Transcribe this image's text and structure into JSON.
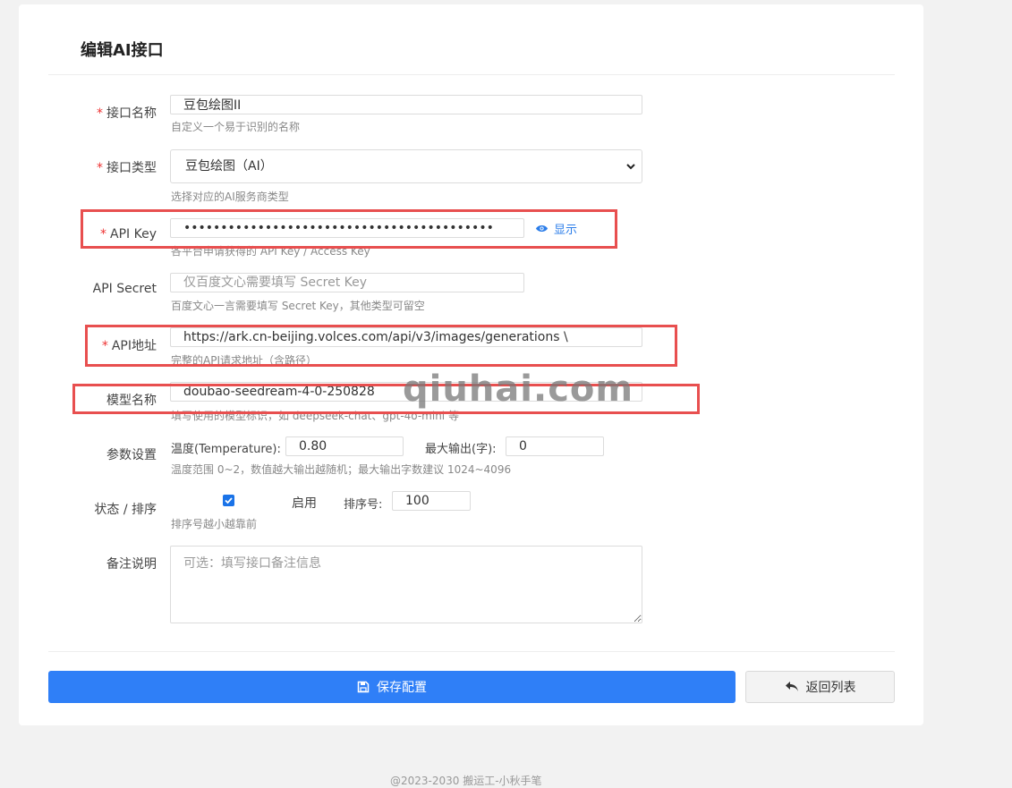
{
  "page": {
    "title": "编辑AI接口"
  },
  "form": {
    "name": {
      "label": "接口名称",
      "required": "*",
      "value": "豆包绘图II",
      "hint": "自定义一个易于识别的名称"
    },
    "type": {
      "label": "接口类型",
      "required": "*",
      "selected": "豆包绘图（AI）",
      "hint": "选择对应的AI服务商类型"
    },
    "api_key": {
      "label": "API Key",
      "required": "*",
      "value": "••••••••••••••••••••••••••••••••••••••••••",
      "show_label": "显示",
      "hint": "各平台申请获得的 API Key / Access Key"
    },
    "api_secret": {
      "label": "API Secret",
      "placeholder": "仅百度文心需要填写 Secret Key",
      "hint": "百度文心一言需要填写 Secret Key，其他类型可留空"
    },
    "api_url": {
      "label": "API地址",
      "required": "*",
      "value": "https://ark.cn-beijing.volces.com/api/v3/images/generations \\",
      "hint": "完整的API请求地址（含路径）"
    },
    "model": {
      "label": "模型名称",
      "value": "doubao-seedream-4-0-250828",
      "hint": "填写使用的模型标识，如 deepseek-chat、gpt-4o-mini 等"
    },
    "params": {
      "label": "参数设置",
      "temperature_label": "温度(Temperature):",
      "temperature_value": "0.80",
      "max_output_label": "最大输出(字):",
      "max_output_value": "0",
      "hint": "温度范围 0~2，数值越大输出越随机；最大输出字数建议 1024~4096"
    },
    "status": {
      "label": "状态 / 排序",
      "enabled": true,
      "enabled_label": "启用",
      "sort_label": "排序号:",
      "sort_value": "100",
      "hint": "排序号越小越靠前"
    },
    "remark": {
      "label": "备注说明",
      "placeholder": "可选：填写接口备注信息"
    }
  },
  "actions": {
    "save_label": "保存配置",
    "back_label": "返回列表"
  },
  "watermark": "qiuhai.com",
  "footer": "@2023-2030 搬运工-小秋手笔",
  "colors": {
    "primary": "#2f7ff7",
    "required": "#e33333",
    "highlight": "#e84f4f"
  }
}
